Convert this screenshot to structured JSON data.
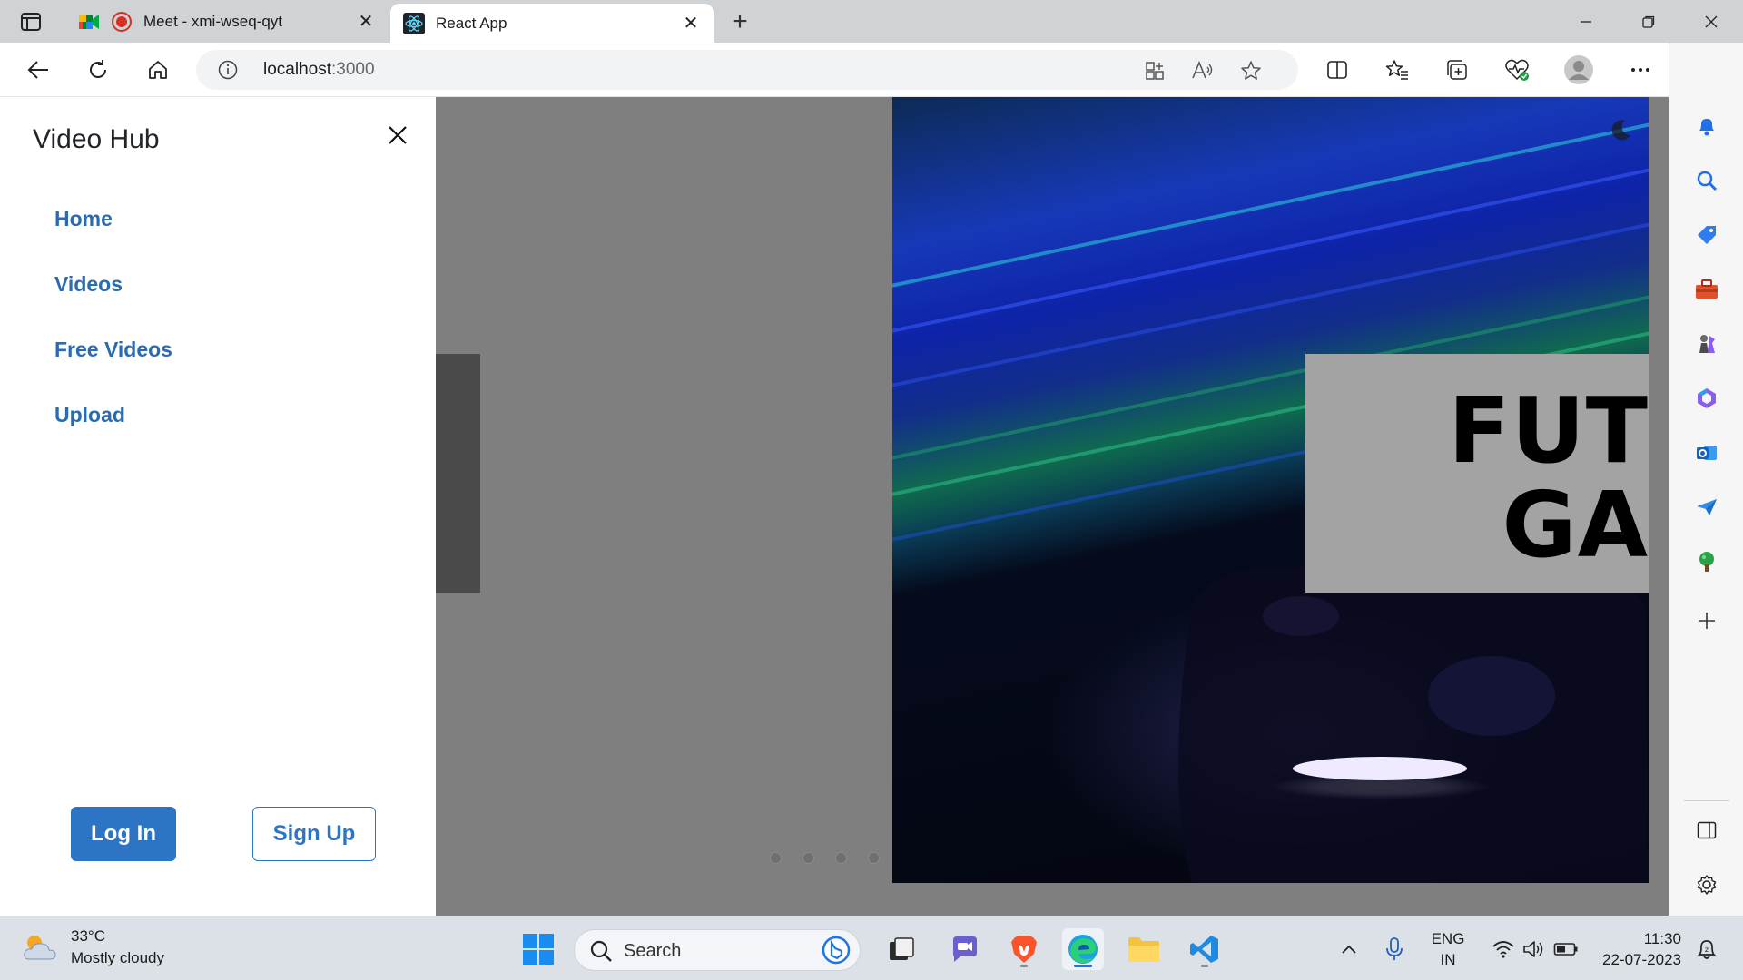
{
  "browser": {
    "tabs": [
      {
        "title": "Meet - xmi-wseq-qyt",
        "active": false
      },
      {
        "title": "React App",
        "active": true
      }
    ],
    "address": {
      "host": "localhost",
      "port": ":3000"
    }
  },
  "drawer": {
    "title": "Video Hub",
    "nav": [
      "Home",
      "Videos",
      "Free Videos",
      "Upload"
    ],
    "login_label": "Log In",
    "signup_label": "Sign Up"
  },
  "hero": {
    "caption_line1": "FUT",
    "caption_line2": "GA",
    "indicators": 4
  },
  "taskbar": {
    "weather_temp": "33°C",
    "weather_desc": "Mostly cloudy",
    "search_placeholder": "Search",
    "lang": "ENG",
    "region": "IN",
    "time": "11:30",
    "date": "22-07-2023"
  },
  "colors": {
    "accent": "#2e74c4",
    "nav_link": "#2a6bb1",
    "overlay_gray": "#7f7f7f"
  }
}
